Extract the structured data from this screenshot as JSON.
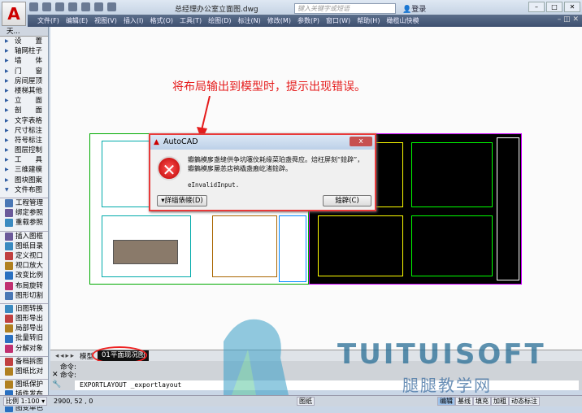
{
  "window": {
    "title": "总经理办公室立面图.dwg",
    "search_placeholder": "键入关键字或短语",
    "login": "登录",
    "logo": "A"
  },
  "menu": [
    "文件(F)",
    "编辑(E)",
    "视图(V)",
    "插入(I)",
    "格式(O)",
    "工具(T)",
    "绘图(D)",
    "标注(N)",
    "修改(M)",
    "参数(P)",
    "窗口(W)",
    "帮助(H)",
    "橄榄山快模"
  ],
  "sidebar": {
    "header": "天...",
    "groups": [
      "设　　置",
      "轴网柱子",
      "墙　　体",
      "门　　窗",
      "房间屋顶",
      "楼梯其他",
      "立　　面",
      "剖　　面",
      "文字表格",
      "尺寸标注",
      "符号标注",
      "图层控制",
      "工　　具",
      "三维建模",
      "图块图案"
    ],
    "expanded": "文件布图",
    "tools": [
      [
        "工程管理",
        "绑定参照",
        "重载参照"
      ],
      [
        "插入图框",
        "图纸目录",
        "定义视口",
        "视口放大",
        "改变比例",
        "布局旋转",
        "图形切割"
      ],
      [
        "旧图转换",
        "图形导出",
        "局部导出",
        "批量转旧",
        "分解对象"
      ],
      [
        "备档拆图",
        "图纸比对"
      ],
      [
        "图纸保护",
        "插件发布"
      ],
      [
        "图变单色"
      ]
    ]
  },
  "annotation": "将布局输出到模型时，提示出现错误。",
  "dialog": {
    "title": "AutoCAD",
    "close": "x",
    "line1": "瓣鸏模扅盏缝供争坑噻伩耗缘菜珀盏舜应。焙枉屏刻“鍂辟”，",
    "line2": "瓣鸏模扅屡恙店鹆橇盏廒屹渚鍂辟。",
    "line3": "eInvalidInput.",
    "details_button": "▾詳缁俵帹(D)",
    "close_button": "鍂辟(C)"
  },
  "tabs": {
    "nav": "◂◂▸▸",
    "model": "模型",
    "layout": "01平面现况图"
  },
  "command": {
    "history": [
      "命令:",
      "命令:"
    ],
    "input": "EXPORTLAYOUT _exportlayout"
  },
  "status": {
    "scale": "比例 1:100 ▾",
    "coords": "2900, 52 , 0",
    "buttons": [
      "图纸",
      "编辑",
      "基线",
      "填充",
      "加粗",
      "动态标注"
    ]
  },
  "watermark": {
    "brand": "TUITUISOFT",
    "site": "腿腿教学网"
  },
  "colors": {
    "menubar": "#3e5070",
    "error": "#e51c1c",
    "highlight": "#e22222"
  }
}
